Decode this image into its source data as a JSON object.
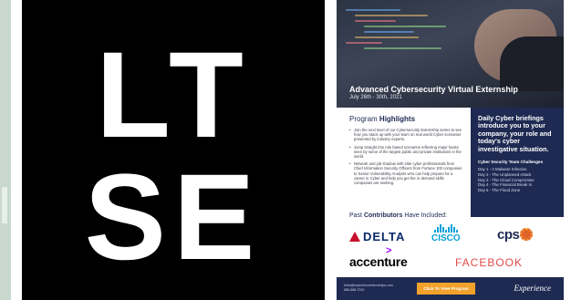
{
  "logo": {
    "line1": "LT",
    "line2": "SE"
  },
  "flyer": {
    "title": "Advanced Cybersecurity Virtual Externship",
    "dates": "July 26th - 30th, 2021",
    "highlights": {
      "title_plain": "Program",
      "title_bold": "Highlights",
      "bullets": [
        "Join the next level of our Cybersecurity Externship series to see how you stack up with your team on real world Cyber scenarios presented by industry experts.",
        "Jump straight into role based scenarios reflecting major hacks seen by some of the largest public and private institutions in the world.",
        "Network and job shadow with elite cyber professionals from Chief Information Security Officers from Fortune 100 companies to Senior Vulnerability Analysts who can help prepare for a career in Cyber and help you get the in demand skills companies are seeking."
      ]
    },
    "daily": {
      "heading": "Daily Cyber briefings introduce you to your company, your role and today's cyber investigative situation.",
      "challenges_title": "Cyber Security Team Challenges",
      "days": [
        "Day 1 - A Malware Infection",
        "Day 2 - The Unplanned Attack",
        "Day 3 - The Cloud Compromise",
        "Day 4 - The Financial Break In",
        "Day 5 - The Flood Zone"
      ]
    },
    "contributors": {
      "title_plain_1": "Past",
      "title_bold": "Contributors",
      "title_plain_2": "Have Included:",
      "logos": {
        "delta": "DELTA",
        "cisco": "CISCO",
        "cps": "cps",
        "accenture": "accenture",
        "accenture_mark": ">",
        "facebook": "FACEBOOK"
      }
    },
    "footer": {
      "contact_line1": "hello@experienceinternships.com",
      "contact_line2": "888-888-7020",
      "cta_label": "Click To View Program",
      "brand": "Experience"
    }
  }
}
